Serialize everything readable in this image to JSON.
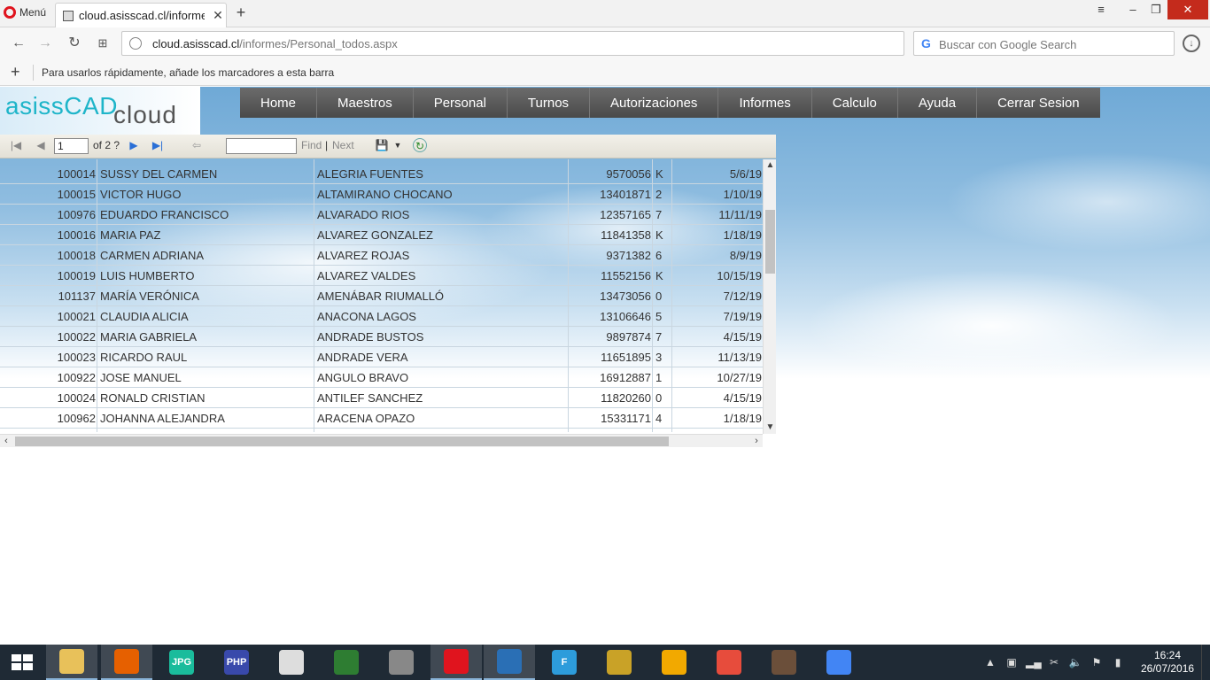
{
  "browser": {
    "menu_label": "Menú",
    "tab_title": "cloud.asisscad.cl/informes/",
    "url_host": "cloud.asisscad.cl",
    "url_path": "/informes/Personal_todos.aspx",
    "search_placeholder": "Buscar con Google Search",
    "bookmarks_hint": "Para usarlos rápidamente, añade los marcadores a esta barra"
  },
  "logo": {
    "part1": "asissCAD",
    "part2": "cloud"
  },
  "nav": {
    "items": [
      {
        "label": "Home"
      },
      {
        "label": "Maestros"
      },
      {
        "label": "Personal"
      },
      {
        "label": "Turnos"
      },
      {
        "label": "Autorizaciones"
      },
      {
        "label": "Informes"
      },
      {
        "label": "Calculo"
      },
      {
        "label": "Ayuda"
      },
      {
        "label": "Cerrar Sesion"
      }
    ]
  },
  "report_toolbar": {
    "current_page": "1",
    "page_total": "of 2 ?",
    "find_label": "Find",
    "separator": "|",
    "next_label": "Next"
  },
  "report": {
    "rows": [
      {
        "id": "100014",
        "nombres": "SUSSY DEL CARMEN",
        "apellidos": "ALEGRIA FUENTES",
        "rut": "9570056",
        "dv": "K",
        "fecha": "5/6/19"
      },
      {
        "id": "100015",
        "nombres": "VICTOR HUGO",
        "apellidos": "ALTAMIRANO CHOCANO",
        "rut": "13401871",
        "dv": "2",
        "fecha": "1/10/19"
      },
      {
        "id": "100976",
        "nombres": "EDUARDO FRANCISCO",
        "apellidos": "ALVARADO RIOS",
        "rut": "12357165",
        "dv": "7",
        "fecha": "11/11/19"
      },
      {
        "id": "100016",
        "nombres": "MARIA PAZ",
        "apellidos": "ALVAREZ GONZALEZ",
        "rut": "11841358",
        "dv": "K",
        "fecha": "1/18/19"
      },
      {
        "id": "100018",
        "nombres": "CARMEN ADRIANA",
        "apellidos": "ALVAREZ ROJAS",
        "rut": "9371382",
        "dv": "6",
        "fecha": "8/9/19"
      },
      {
        "id": "100019",
        "nombres": "LUIS HUMBERTO",
        "apellidos": "ALVAREZ VALDES",
        "rut": "11552156",
        "dv": "K",
        "fecha": "10/15/19"
      },
      {
        "id": "101137",
        "nombres": "MARÍA VERÓNICA",
        "apellidos": "AMENÁBAR RIUMALLÓ",
        "rut": "13473056",
        "dv": "0",
        "fecha": "7/12/19"
      },
      {
        "id": "100021",
        "nombres": "CLAUDIA ALICIA",
        "apellidos": "ANACONA LAGOS",
        "rut": "13106646",
        "dv": "5",
        "fecha": "7/19/19"
      },
      {
        "id": "100022",
        "nombres": "MARIA GABRIELA",
        "apellidos": "ANDRADE BUSTOS",
        "rut": "9897874",
        "dv": "7",
        "fecha": "4/15/19"
      },
      {
        "id": "100023",
        "nombres": "RICARDO RAUL",
        "apellidos": "ANDRADE VERA",
        "rut": "11651895",
        "dv": "3",
        "fecha": "11/13/19"
      },
      {
        "id": "100922",
        "nombres": "JOSE MANUEL",
        "apellidos": "ANGULO BRAVO",
        "rut": "16912887",
        "dv": "1",
        "fecha": "10/27/19"
      },
      {
        "id": "100024",
        "nombres": "RONALD CRISTIAN",
        "apellidos": "ANTILEF SANCHEZ",
        "rut": "11820260",
        "dv": "0",
        "fecha": "4/15/19"
      },
      {
        "id": "100962",
        "nombres": "JOHANNA ALEJANDRA",
        "apellidos": "ARACENA OPAZO",
        "rut": "15331171",
        "dv": "4",
        "fecha": "1/18/19"
      }
    ]
  },
  "taskbar": {
    "apps": [
      {
        "icon": "file-explorer-icon",
        "label": "",
        "color": "#e8c15a"
      },
      {
        "icon": "firefox-icon",
        "label": "",
        "color": "#e66000"
      },
      {
        "icon": "jpg-app-icon",
        "label": "JPG",
        "color": "#1abc9c"
      },
      {
        "icon": "php-icon",
        "label": "PHP",
        "color": "#3949ab"
      },
      {
        "icon": "document-shortcut-icon",
        "label": "",
        "color": "#dddddd"
      },
      {
        "icon": "excel-shortcut-icon",
        "label": "",
        "color": "#2e7d32"
      },
      {
        "icon": "disc-app-icon",
        "label": "",
        "color": "#888888"
      },
      {
        "icon": "opera-icon",
        "label": "",
        "color": "#e0141e"
      },
      {
        "icon": "thunderbird-icon",
        "label": "",
        "color": "#2a6fb5"
      },
      {
        "icon": "filezilla-icon",
        "label": "F",
        "color": "#2d9cdb"
      },
      {
        "icon": "tools-icon",
        "label": "",
        "color": "#c9a227"
      },
      {
        "icon": "virtualbox-icon",
        "label": "",
        "color": "#f2a900"
      },
      {
        "icon": "pinwheel-app-icon",
        "label": "",
        "color": "#e74c3c"
      },
      {
        "icon": "game-icon",
        "label": "",
        "color": "#6b4f3a"
      },
      {
        "icon": "chrome-icon",
        "label": "",
        "color": "#4285f4"
      }
    ],
    "time": "16:24",
    "date": "26/07/2016"
  }
}
